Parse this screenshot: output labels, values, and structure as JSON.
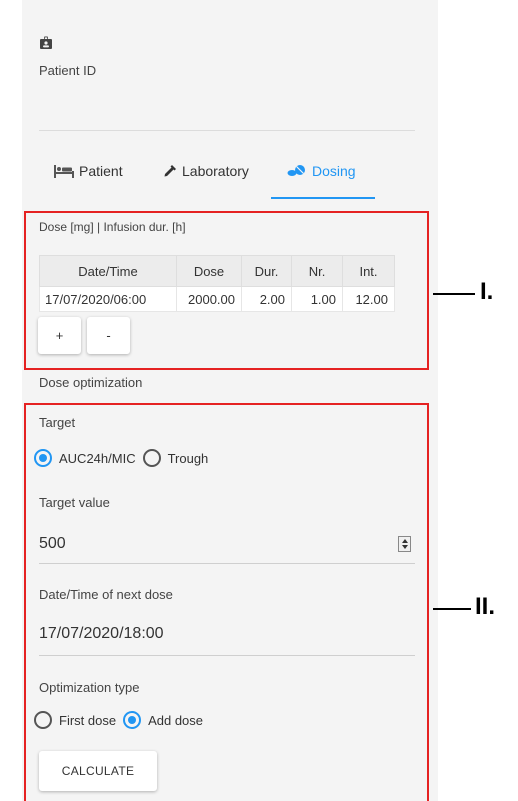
{
  "patient": {
    "id_label": "Patient ID"
  },
  "tabs": [
    {
      "label": "Patient",
      "icon": "patient-bed-icon",
      "active": false
    },
    {
      "label": "Laboratory",
      "icon": "eyedropper-icon",
      "active": false
    },
    {
      "label": "Dosing",
      "icon": "pills-icon",
      "active": true
    }
  ],
  "dose": {
    "title": "Dose [mg] | Infusion dur. [h]",
    "columns": [
      "Date/Time",
      "Dose",
      "Dur.",
      "Nr.",
      "Int."
    ],
    "rows": [
      [
        "17/07/2020/06:00",
        "2000.00",
        "2.00",
        "1.00",
        "12.00"
      ]
    ],
    "add_label": "+",
    "remove_label": "-"
  },
  "optimization": {
    "title": "Dose optimization",
    "target_label": "Target",
    "target_options": [
      {
        "label": "AUC24h/MIC",
        "checked": true
      },
      {
        "label": "Trough",
        "checked": false
      }
    ],
    "target_value_label": "Target value",
    "target_value": "500",
    "next_dose_label": "Date/Time of next dose",
    "next_dose_value": "17/07/2020/18:00",
    "type_label": "Optimization type",
    "type_options": [
      {
        "label": "First dose",
        "checked": false
      },
      {
        "label": "Add dose",
        "checked": true
      }
    ],
    "calculate_label": "CALCULATE"
  },
  "callouts": {
    "one": "I.",
    "two": "II."
  },
  "colors": {
    "accent": "#2196f3",
    "highlight_box": "#e52222",
    "panel_bg": "#f4f4f4"
  }
}
